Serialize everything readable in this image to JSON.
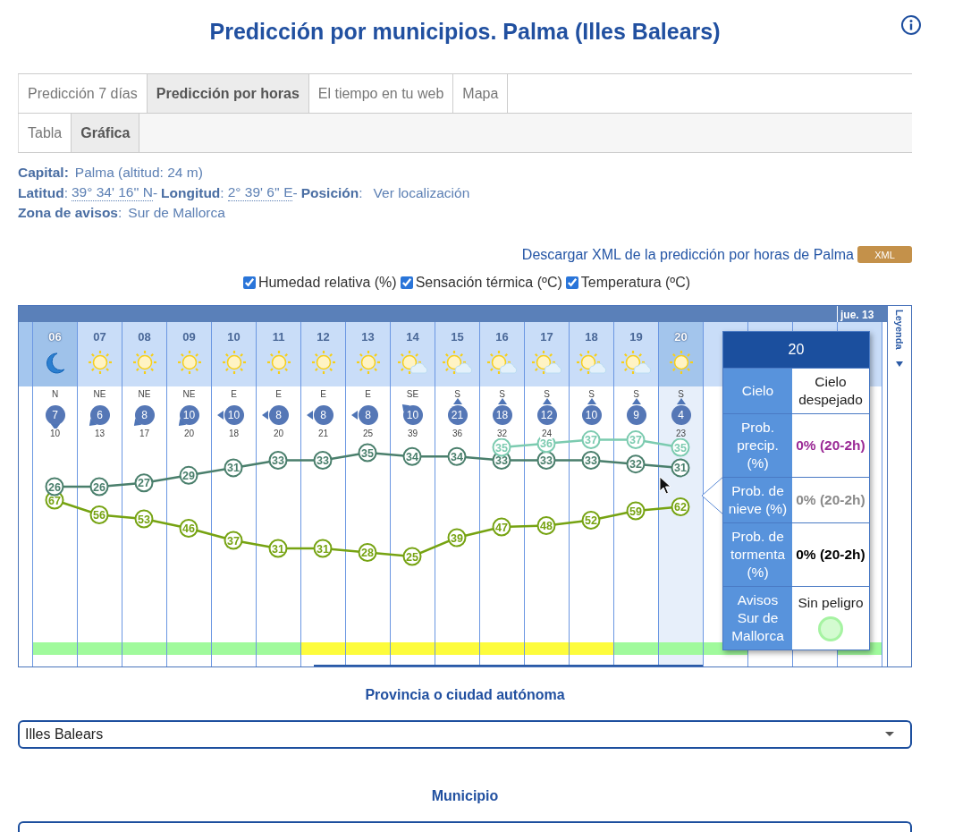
{
  "page_title": "Predicción por municipios. Palma (Illes Balears)",
  "tabs": [
    {
      "label": "Predicción 7 días",
      "selected": false
    },
    {
      "label": "Predicción por horas",
      "selected": true
    },
    {
      "label": "El tiempo en tu web",
      "selected": false
    },
    {
      "label": "Mapa",
      "selected": false
    }
  ],
  "subtabs": [
    {
      "label": "Tabla",
      "selected": false
    },
    {
      "label": "Gráfica",
      "selected": true
    }
  ],
  "info_lines": [
    [
      {
        "kind": "label",
        "text": "Capital:"
      },
      {
        "kind": "value",
        "text": "Palma (altitud: 24 m)"
      }
    ],
    [
      {
        "kind": "label",
        "text": "Latitud"
      },
      {
        "kind": "plain",
        "text": ":"
      },
      {
        "kind": "coord",
        "text": "39° 34' 16'' N"
      },
      {
        "kind": "plain",
        "text": "-"
      },
      {
        "kind": "label",
        "text": "Longitud"
      },
      {
        "kind": "plain",
        "text": ":"
      },
      {
        "kind": "coord",
        "text": "2° 39' 6'' E"
      },
      {
        "kind": "plain",
        "text": "-"
      },
      {
        "kind": "label",
        "text": "Posición"
      },
      {
        "kind": "plain",
        "text": ":"
      },
      {
        "kind": "link",
        "text": "Ver localización"
      }
    ],
    [
      {
        "kind": "label",
        "text": "Zona de avisos"
      },
      {
        "kind": "plain",
        "text": ":"
      },
      {
        "kind": "value",
        "text": "Sur de Mallorca"
      }
    ]
  ],
  "download": {
    "text": "Descargar XML de la predicción por horas de Palma",
    "button": "XML"
  },
  "series_toggles": [
    {
      "label": "Humedad relativa (%)",
      "checked": true
    },
    {
      "label": "Sensación térmica (ºC)",
      "checked": true
    },
    {
      "label": "Temperatura (ºC)",
      "checked": true
    }
  ],
  "chart": {
    "day_label": "jue. 13",
    "legend_label": "Leyenda",
    "hours": [
      {
        "hour": "06",
        "current": true,
        "selected": false,
        "sky": {
          "kind": "moon"
        },
        "dir": "N",
        "wind_arrow": {
          "kind": "down"
        },
        "speed": "7",
        "gust": "10",
        "temp": "26",
        "humidity": "67",
        "warning": {
          "color": "#a0fa9c"
        }
      },
      {
        "hour": "07",
        "current": false,
        "selected": false,
        "sky": {
          "kind": "sun"
        },
        "dir": "NE",
        "wind_arrow": {
          "kind": "down-left"
        },
        "speed": "6",
        "gust": "13",
        "temp": "26",
        "humidity": "56",
        "warning": {
          "color": "#a0fa9c"
        }
      },
      {
        "hour": "08",
        "current": false,
        "selected": false,
        "sky": {
          "kind": "sun"
        },
        "dir": "NE",
        "wind_arrow": {
          "kind": "down-left"
        },
        "speed": "8",
        "gust": "17",
        "temp": "27",
        "humidity": "53",
        "warning": {
          "color": "#a0fa9c"
        }
      },
      {
        "hour": "09",
        "current": false,
        "selected": false,
        "sky": {
          "kind": "sun"
        },
        "dir": "NE",
        "wind_arrow": {
          "kind": "down-left"
        },
        "speed": "10",
        "gust": "20",
        "temp": "29",
        "humidity": "46",
        "warning": {
          "color": "#a0fa9c"
        }
      },
      {
        "hour": "10",
        "current": false,
        "selected": false,
        "sky": {
          "kind": "sun"
        },
        "dir": "E",
        "wind_arrow": {
          "kind": "left"
        },
        "speed": "10",
        "gust": "18",
        "temp": "31",
        "humidity": "37",
        "warning": {
          "color": "#a0fa9c"
        }
      },
      {
        "hour": "11",
        "current": false,
        "selected": false,
        "sky": {
          "kind": "sun"
        },
        "dir": "E",
        "wind_arrow": {
          "kind": "left"
        },
        "speed": "8",
        "gust": "20",
        "temp": "33",
        "humidity": "31",
        "warning": {
          "color": "#a0fa9c"
        }
      },
      {
        "hour": "12",
        "current": false,
        "selected": false,
        "sky": {
          "kind": "sun"
        },
        "dir": "E",
        "wind_arrow": {
          "kind": "left"
        },
        "speed": "8",
        "gust": "21",
        "temp": "33",
        "humidity": "31",
        "warning": {
          "color": "#fdfc3c"
        }
      },
      {
        "hour": "13",
        "current": false,
        "selected": false,
        "sky": {
          "kind": "sun"
        },
        "dir": "E",
        "wind_arrow": {
          "kind": "left"
        },
        "speed": "8",
        "gust": "25",
        "temp": "35",
        "humidity": "28",
        "warning": {
          "color": "#fdfc3c"
        }
      },
      {
        "hour": "14",
        "current": false,
        "selected": false,
        "sky": {
          "kind": "sun-cloud"
        },
        "dir": "SE",
        "wind_arrow": {
          "kind": "up-left"
        },
        "speed": "10",
        "gust": "39",
        "temp": "34",
        "humidity": "25",
        "warning": {
          "color": "#fdfc3c"
        }
      },
      {
        "hour": "15",
        "current": false,
        "selected": false,
        "sky": {
          "kind": "sun-cloud"
        },
        "dir": "S",
        "wind_arrow": {
          "kind": "up"
        },
        "speed": "21",
        "gust": "36",
        "temp": "34",
        "humidity": "39",
        "warning": {
          "color": "#fdfc3c"
        }
      },
      {
        "hour": "16",
        "current": false,
        "selected": false,
        "sky": {
          "kind": "sun-cloud"
        },
        "dir": "S",
        "wind_arrow": {
          "kind": "up"
        },
        "speed": "18",
        "gust": "32",
        "temp": "33",
        "feels": "35",
        "humidity": "47",
        "warning": {
          "color": "#fdfc3c"
        }
      },
      {
        "hour": "17",
        "current": false,
        "selected": false,
        "sky": {
          "kind": "sun-cloud"
        },
        "dir": "S",
        "wind_arrow": {
          "kind": "up"
        },
        "speed": "12",
        "gust": "24",
        "temp": "33",
        "feels": "36",
        "humidity": "48",
        "warning": {
          "color": "#fdfc3c"
        }
      },
      {
        "hour": "18",
        "current": false,
        "selected": false,
        "sky": {
          "kind": "sun-cloud"
        },
        "dir": "S",
        "wind_arrow": {
          "kind": "up"
        },
        "speed": "10",
        "temp": "33",
        "feels": "37",
        "humidity": "52",
        "warning": {
          "color": "#fdfc3c"
        }
      },
      {
        "hour": "19",
        "current": false,
        "selected": false,
        "sky": {
          "kind": "sun-cloud"
        },
        "dir": "S",
        "wind_arrow": {
          "kind": "up"
        },
        "speed": "9",
        "temp": "32",
        "feels": "37",
        "humidity": "59",
        "warning": {
          "color": "#a0fa9c"
        }
      },
      {
        "hour": "20",
        "current": false,
        "selected": true,
        "sky": {
          "kind": "sun"
        },
        "dir": "S",
        "wind_arrow": {
          "kind": "up"
        },
        "speed": "4",
        "gust": "23",
        "temp": "31",
        "feels": "35",
        "humidity": "62",
        "warning": {
          "color": "#a0fa9c"
        }
      },
      {
        "warning": {
          "color": "#a0fa9c"
        }
      },
      {
        "selected": false
      },
      {
        "selected": false
      },
      {
        "warning": {
          "color": "#a0fa9c"
        }
      }
    ]
  },
  "tooltip": {
    "title": "20",
    "rows": [
      {
        "kind": "sky",
        "label": "Cielo",
        "value": "Cielo despejado"
      },
      {
        "kind": "precip",
        "label": "Prob. precip. (%)",
        "value": "0% (20-2h)"
      },
      {
        "kind": "snow",
        "label": "Prob. de nieve (%)",
        "value": "0% (20-2h)"
      },
      {
        "kind": "storm",
        "label": "Prob. de tormenta (%)",
        "value": "0% (20-2h)"
      },
      {
        "kind": "warning",
        "label": "Avisos Sur de Mallorca",
        "value": "Sin peligro",
        "color": "#d3fbd0"
      }
    ]
  },
  "province": {
    "label": "Provincia o ciudad autónoma",
    "value": "Illes Balears"
  },
  "municipality": {
    "label": "Municipio"
  }
}
